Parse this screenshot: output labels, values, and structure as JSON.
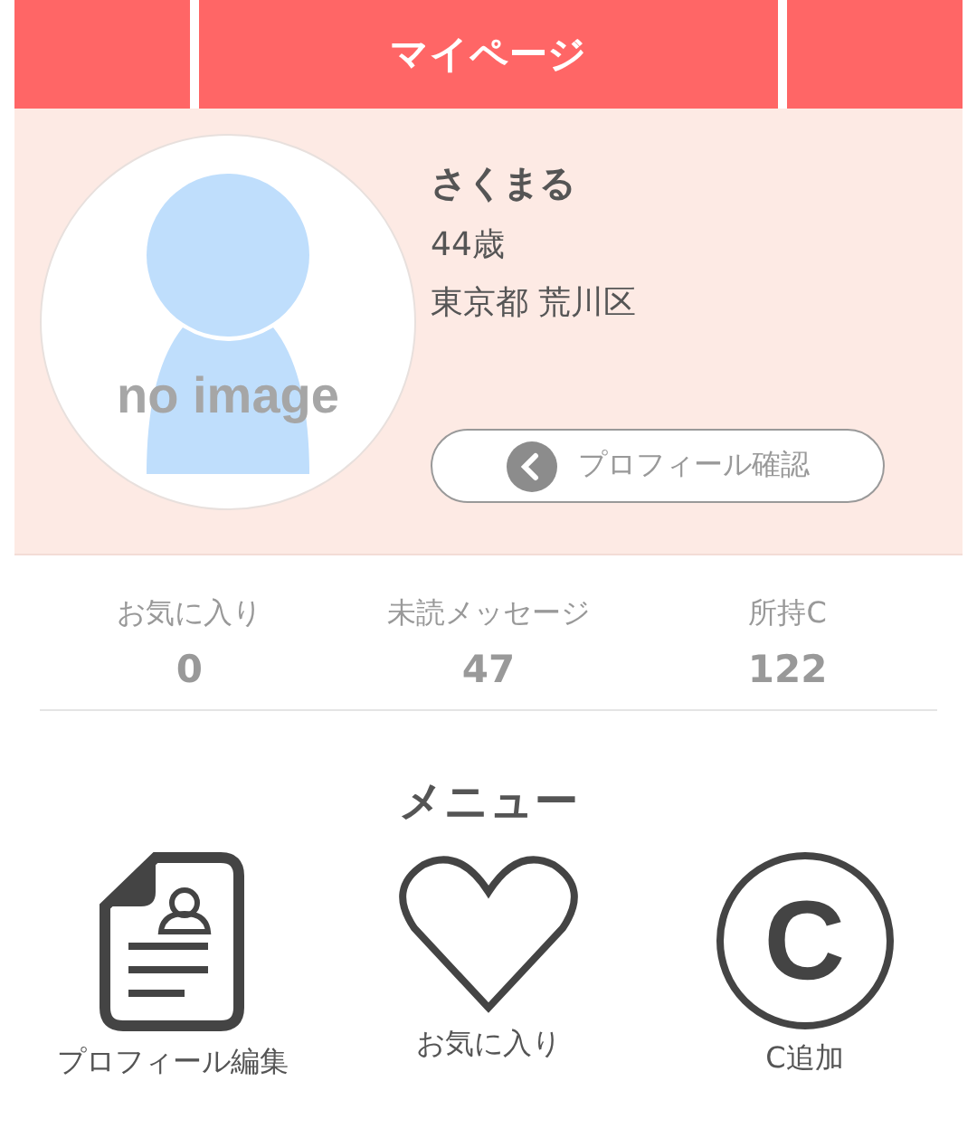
{
  "header": {
    "title": "マイページ"
  },
  "profile": {
    "avatar_text": "no image",
    "name": "さくまる",
    "age": "44歳",
    "location": "東京都 荒川区",
    "button": "プロフィール確認"
  },
  "stats": [
    {
      "label": "お気に入り",
      "value": "0"
    },
    {
      "label": "未読メッセージ",
      "value": "47"
    },
    {
      "label": "所持C",
      "value": "122"
    }
  ],
  "menu": {
    "title": "メニュー",
    "items": [
      {
        "label": "プロフィール編集",
        "kind": "profile"
      },
      {
        "label": "お気に入り",
        "kind": "heart"
      },
      {
        "label": "C追加",
        "kind": "coin",
        "glyph": "C"
      }
    ]
  }
}
